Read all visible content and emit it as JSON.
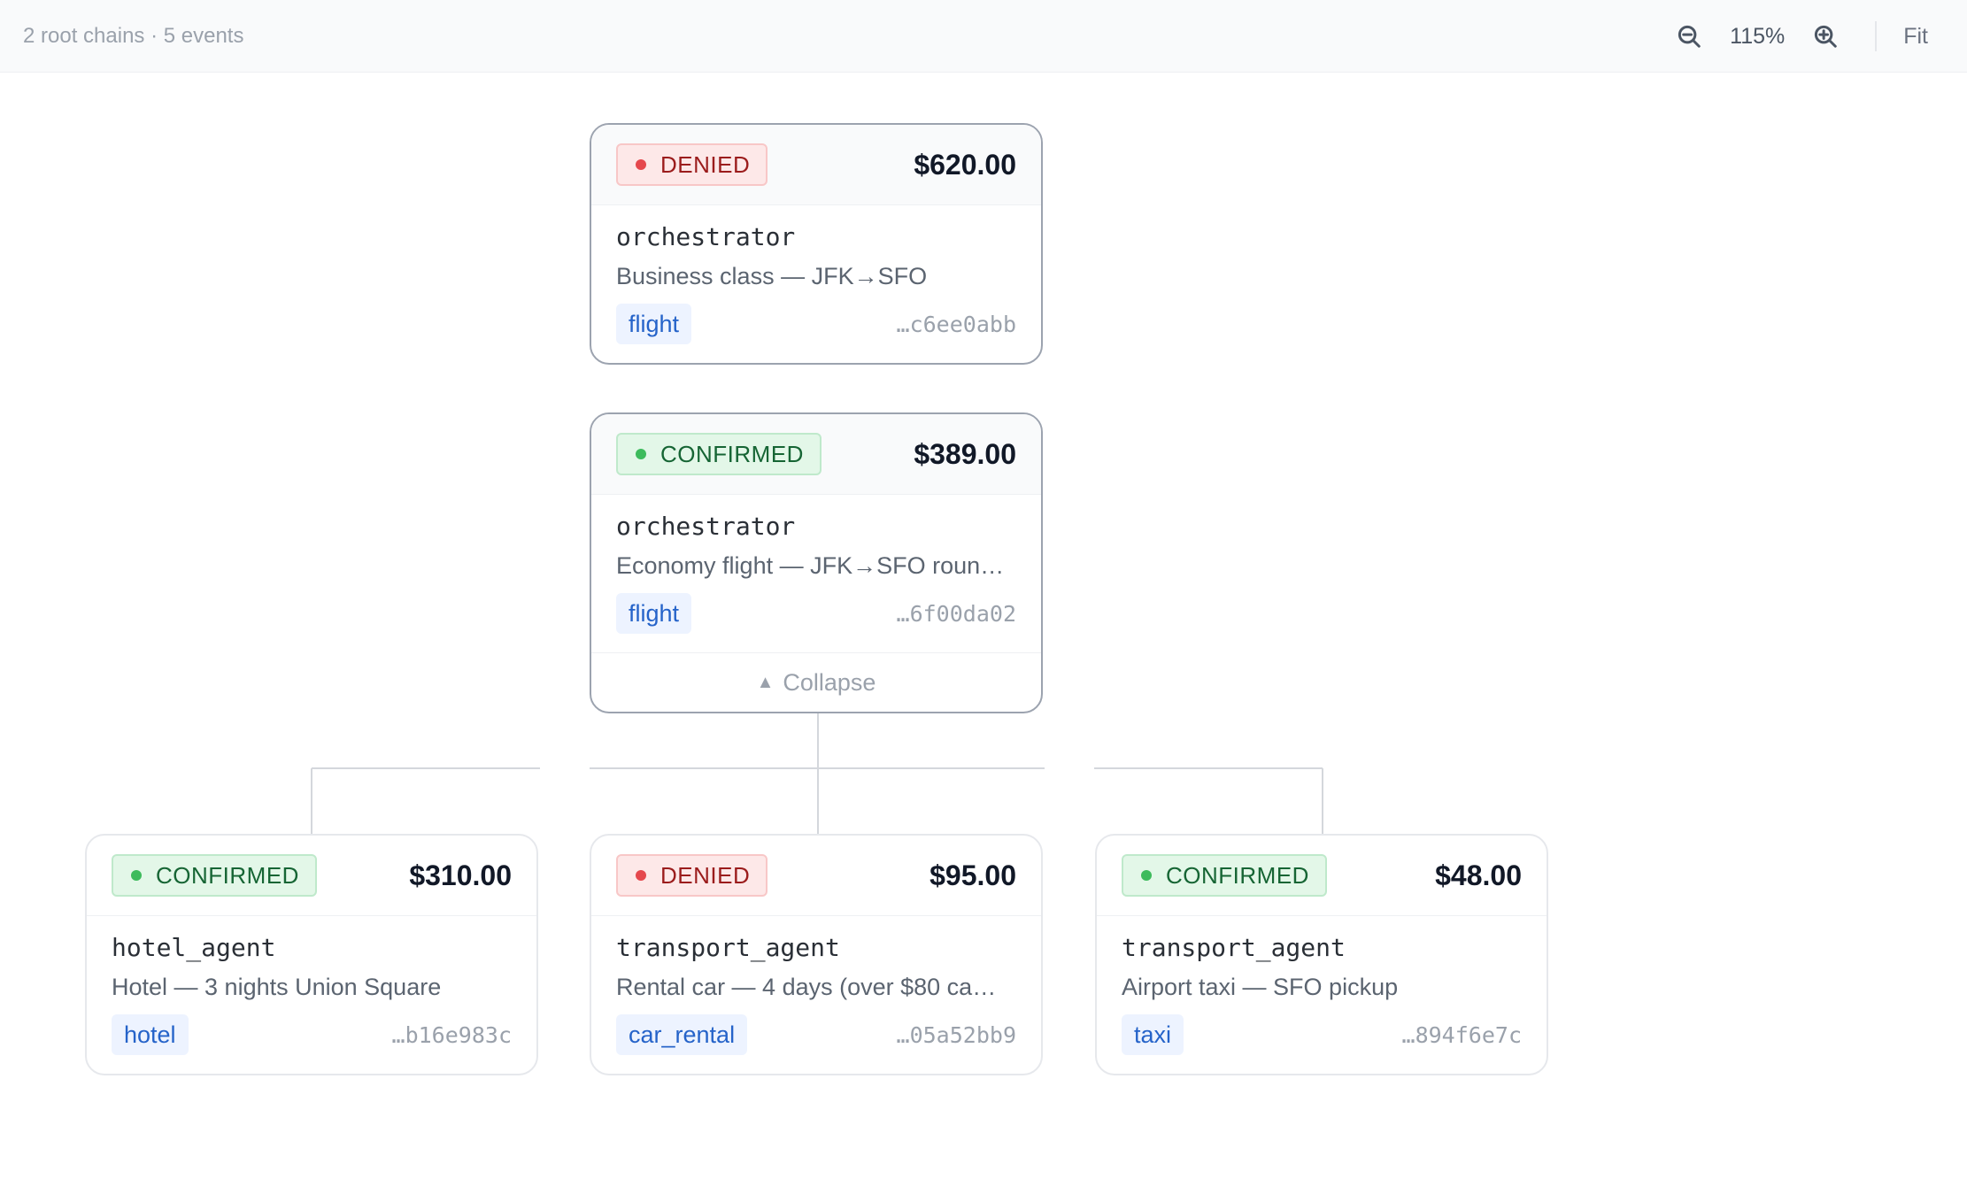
{
  "toolbar": {
    "summary": "2 root chains · 5 events",
    "zoom_level": "115%",
    "fit_label": "Fit",
    "zoom_out_icon": "zoom-out-icon",
    "zoom_in_icon": "zoom-in-icon"
  },
  "colors": {
    "denied_bg": "#fde8e8",
    "denied_text": "#9b1c1c",
    "denied_dot": "#e5484d",
    "confirmed_bg": "#e3f7e8",
    "confirmed_text": "#166534",
    "confirmed_dot": "#3dbb5c",
    "tag_bg": "#edf3ff",
    "tag_text": "#2563c9"
  },
  "events": [
    {
      "status": "DENIED",
      "amount": "$620.00",
      "agent": "orchestrator",
      "description": "Business class — JFK→SFO",
      "tag": "flight",
      "hash": "…c6ee0abb"
    },
    {
      "status": "CONFIRMED",
      "amount": "$389.00",
      "agent": "orchestrator",
      "description": "Economy flight — JFK→SFO roun…",
      "tag": "flight",
      "hash": "…6f00da02",
      "collapse_label": "Collapse"
    },
    {
      "status": "CONFIRMED",
      "amount": "$310.00",
      "agent": "hotel_agent",
      "description": "Hotel — 3 nights Union Square",
      "tag": "hotel",
      "hash": "…b16e983c"
    },
    {
      "status": "DENIED",
      "amount": "$95.00",
      "agent": "transport_agent",
      "description": "Rental car — 4 days (over $80 ca…",
      "tag": "car_rental",
      "hash": "…05a52bb9"
    },
    {
      "status": "CONFIRMED",
      "amount": "$48.00",
      "agent": "transport_agent",
      "description": "Airport taxi — SFO pickup",
      "tag": "taxi",
      "hash": "…894f6e7c"
    }
  ]
}
